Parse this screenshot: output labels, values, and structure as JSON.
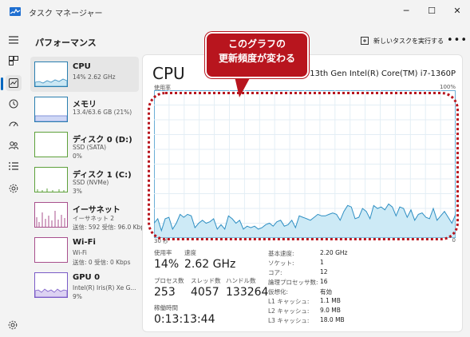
{
  "window": {
    "title": "タスク マネージャー",
    "minimize": "─",
    "maximize": "☐",
    "close": "✕"
  },
  "header": {
    "title": "パフォーマンス",
    "run_task": "新しいタスクを実行する",
    "more": "•••"
  },
  "sidebar": [
    {
      "name": "CPU",
      "sub": "14%  2.62 GHz",
      "sub2": ""
    },
    {
      "name": "メモリ",
      "sub": "13.4/63.6 GB (21%)",
      "sub2": ""
    },
    {
      "name": "ディスク 0 (D:)",
      "sub": "SSD (SATA)",
      "sub2": "0%"
    },
    {
      "name": "ディスク 1 (C:)",
      "sub": "SSD (NVMe)",
      "sub2": "3%"
    },
    {
      "name": "イーサネット",
      "sub": "イーサネット 2",
      "sub2": "送信: 592  受信: 96.0 Kbps"
    },
    {
      "name": "Wi-Fi",
      "sub": "Wi-Fi",
      "sub2": "送信: 0  受信: 0 Kbps"
    },
    {
      "name": "GPU 0",
      "sub": "Intel(R) Iris(R) Xe G...",
      "sub2": "9%"
    }
  ],
  "cpu": {
    "heading": "CPU",
    "model": "13th Gen Intel(R) Core(TM) i7-1360P",
    "usage_label": "使用率",
    "max_label": "100%",
    "time_label": "30 秒",
    "zero_label": "0",
    "graph_usage_pct": [
      10,
      13,
      5,
      13,
      14,
      6,
      10,
      16,
      14,
      16,
      15,
      7,
      10,
      12,
      10,
      11,
      13,
      6,
      9,
      6,
      15,
      13,
      10,
      12,
      6,
      8,
      7,
      8,
      6,
      7,
      9,
      10,
      8,
      11,
      12,
      8,
      9,
      12,
      7,
      15,
      14,
      13,
      12,
      14,
      16,
      15,
      15,
      16,
      17,
      16,
      12,
      18,
      22,
      21,
      13,
      14,
      20,
      18,
      13,
      22,
      20,
      21,
      19,
      23,
      21,
      15,
      21,
      20,
      14,
      19,
      12,
      16,
      17,
      14,
      13,
      20,
      12,
      15,
      18,
      14,
      10,
      16
    ],
    "stats": {
      "usage": {
        "label": "使用率",
        "value": "14%"
      },
      "speed": {
        "label": "速度",
        "value": "2.62 GHz"
      },
      "processes": {
        "label": "プロセス数",
        "value": "253"
      },
      "threads": {
        "label": "スレッド数",
        "value": "4057"
      },
      "handles": {
        "label": "ハンドル数",
        "value": "133264"
      },
      "uptime": {
        "label": "稼働時間",
        "value": "0:13:13:44"
      }
    },
    "specs": [
      {
        "k": "基本速度:",
        "v": "2.20 GHz"
      },
      {
        "k": "ソケット:",
        "v": "1"
      },
      {
        "k": "コア:",
        "v": "12"
      },
      {
        "k": "論理プロセッサ数:",
        "v": "16"
      },
      {
        "k": "仮想化:",
        "v": "有効"
      },
      {
        "k": "L1 キャッシュ:",
        "v": "1.1 MB"
      },
      {
        "k": "L2 キャッシュ:",
        "v": "9.0 MB"
      },
      {
        "k": "L3 キャッシュ:",
        "v": "18.0 MB"
      }
    ]
  },
  "annotation": {
    "line1": "このグラフの",
    "line2": "更新頻度が変わる",
    "color": "#b8151e"
  }
}
